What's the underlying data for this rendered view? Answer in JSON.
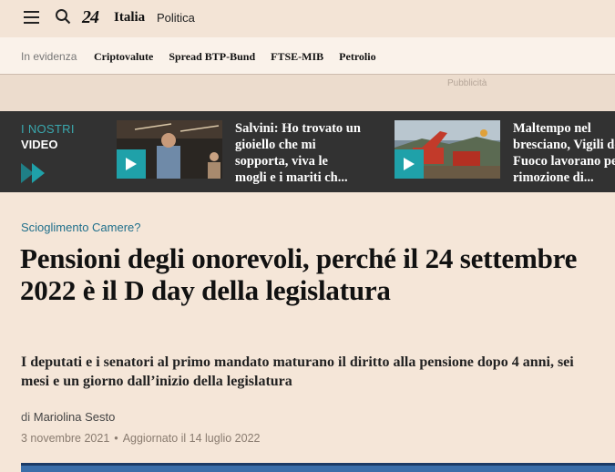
{
  "header": {
    "logo": "24",
    "section": "Italia",
    "subsection": "Politica"
  },
  "trending": {
    "label": "In evidenza",
    "items": [
      "Criptovalute",
      "Spread BTP-Bund",
      "FTSE-MIB",
      "Petrolio"
    ]
  },
  "ad": {
    "label": "Pubblicità"
  },
  "videos": {
    "label_line1": "I NOSTRI",
    "label_line2": "VIDEO",
    "items": [
      {
        "title": "Salvini: Ho trovato un gioiello che mi sopporta, viva le mogli e i mariti ch..."
      },
      {
        "title": "Maltempo nel bresciano, Vigili del Fuoco lavorano per la rimozione di..."
      }
    ]
  },
  "article": {
    "kicker": "Scioglimento Camere?",
    "headline": "Pensioni degli onorevoli, perché il 24 settembre 2022 è il D day della legislatura",
    "subhead": "I deputati e i senatori al primo mandato maturano il diritto alla pensione dopo 4 anni, sei mesi e un giorno dall’inizio della legislatura",
    "byline_prefix": "di",
    "author": "Mariolina Sesto",
    "date": "3 novembre 2021",
    "updated": "Aggiornato il 14 luglio 2022"
  },
  "colors": {
    "page_bg": "#f5e6d8",
    "accent_teal": "#1fa1a9",
    "kicker_blue": "#1f6f8b",
    "video_bg": "#323232"
  }
}
